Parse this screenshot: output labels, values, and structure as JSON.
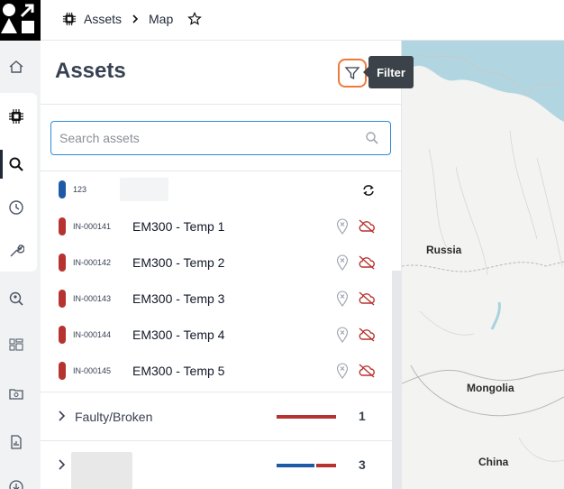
{
  "breadcrumb": {
    "root": "Assets",
    "current": "Map"
  },
  "panel": {
    "title": "Assets",
    "tooltip": "Filter",
    "search": {
      "placeholder": "Search assets",
      "value": ""
    }
  },
  "assets_partial": {
    "code": "123"
  },
  "assets": [
    {
      "code": "IN-000141",
      "name": "EM300 - Temp 1",
      "status": "faulty"
    },
    {
      "code": "IN-000142",
      "name": "EM300 - Temp 2",
      "status": "faulty"
    },
    {
      "code": "IN-000143",
      "name": "EM300 - Temp 3",
      "status": "faulty"
    },
    {
      "code": "IN-000144",
      "name": "EM300 - Temp 4",
      "status": "faulty"
    },
    {
      "code": "IN-000145",
      "name": "EM300 - Temp 5",
      "status": "faulty"
    }
  ],
  "groups": [
    {
      "label": "Faulty/Broken",
      "count": "1"
    },
    {
      "label": "",
      "count": "3"
    }
  ],
  "map": {
    "labels": {
      "russia": "Russia",
      "mongolia": "Mongolia",
      "china": "China"
    }
  },
  "colors": {
    "faulty": "#b7332f",
    "ok": "#1e5aa8",
    "accent": "#f07a3a",
    "focus": "#2e8bd9"
  },
  "icons": {
    "rail": [
      "home-icon",
      "chip-icon",
      "search-icon",
      "clock-icon",
      "wrench-icon",
      "zoom-pin-icon",
      "dashboard-icon",
      "folder-gear-icon",
      "report-icon",
      "download-icon"
    ]
  }
}
